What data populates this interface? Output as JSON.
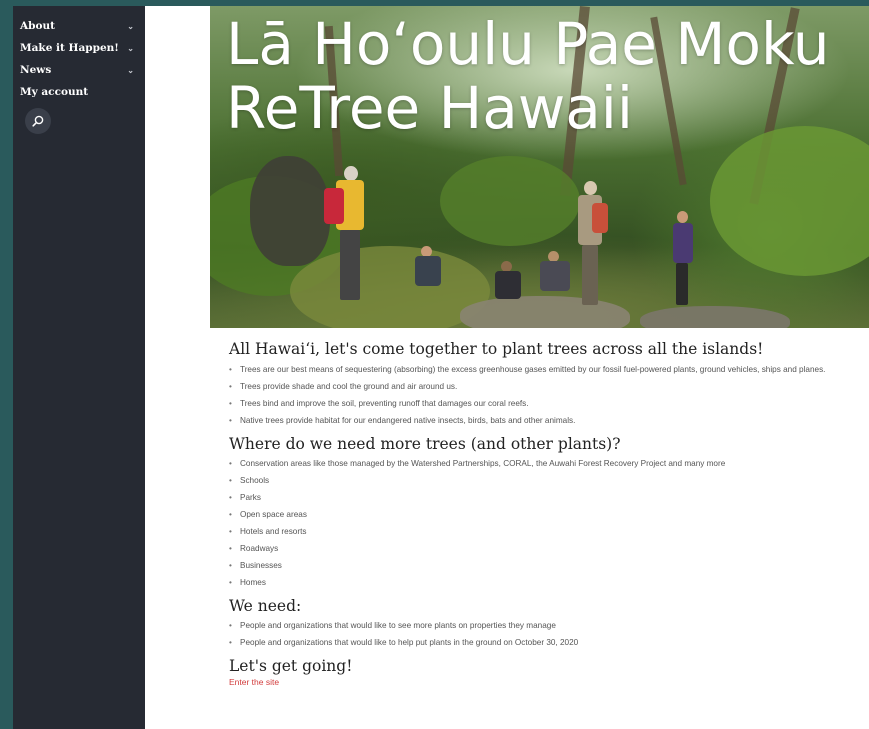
{
  "sidebar": {
    "items": [
      {
        "label": "About",
        "has_caret": true
      },
      {
        "label": "Make it Happen!",
        "has_caret": true
      },
      {
        "label": "News",
        "has_caret": true
      },
      {
        "label": "My account",
        "has_caret": false
      }
    ],
    "search_icon": "search-icon"
  },
  "hero": {
    "title_line1": "Lā Ho‘oulu Pae Moku",
    "title_line2": "ReTree Hawaii"
  },
  "sections": {
    "intro": {
      "heading": "All Hawai‘i, let's come together to plant trees across all the islands!",
      "items": [
        "Trees are our best means of sequestering (absorbing) the excess greenhouse gases emitted by our fossil fuel-powered plants, ground vehicles, ships and planes.",
        "Trees provide shade and cool the ground and air around us.",
        "Trees bind and improve the soil, preventing runoff that damages our coral reefs.",
        "Native trees provide habitat for our endangered native insects, birds, bats and other animals."
      ]
    },
    "where": {
      "heading": "Where do we need more trees (and other plants)?",
      "items": [
        "Conservation areas like those managed by the Watershed Partnerships, CORAL, the Auwahi Forest Recovery Project and many more",
        "Schools",
        "Parks",
        "Open space areas",
        "Hotels and resorts",
        "Roadways",
        "Businesses",
        "Homes"
      ]
    },
    "need": {
      "heading": "We need:",
      "items": [
        "People and organizations that would like to see more plants on properties they manage",
        "People and organizations that would like to help put plants in the ground on October 30, 2020"
      ]
    },
    "go": {
      "heading": "Let's get going!",
      "link": "Enter the site"
    }
  },
  "colors": {
    "sidebar_bg": "#262a33",
    "outer_bg": "#2a5a5c",
    "link": "#d23c3c"
  }
}
